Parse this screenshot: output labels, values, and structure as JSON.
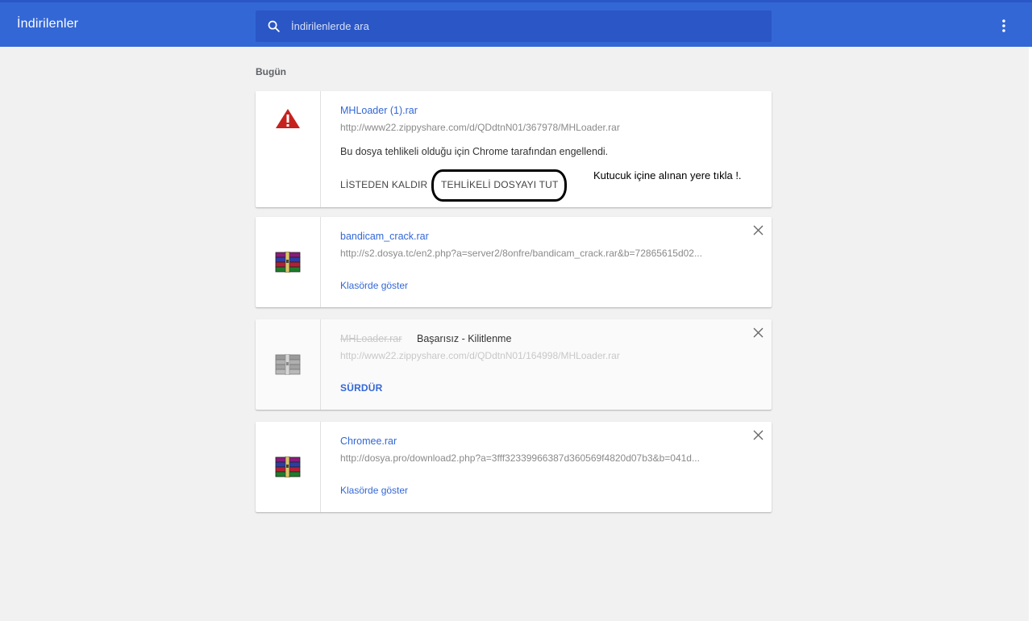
{
  "header": {
    "title": "İndirilenler",
    "search_placeholder": "İndirilenlerde ara"
  },
  "section": {
    "title": "Bugün"
  },
  "downloads": [
    {
      "file_name": "MHLoader (1).rar",
      "url": "http://www22.zippyshare.com/d/QDdtnN01/367978/MHLoader.rar",
      "description": "Bu dosya tehlikeli olduğu için Chrome tarafından engellendi.",
      "action_remove": "LİSTEDEN KALDIR",
      "action_keep": "TEHLİKELİ DOSYAYI TUT",
      "icon": "warning-icon"
    },
    {
      "file_name": "bandicam_crack.rar",
      "url": "http://s2.dosya.tc/en2.php?a=server2/8onfre/bandicam_crack.rar&b=72865615d02...",
      "action": "Klasörde göster",
      "icon": "winrar-icon"
    },
    {
      "file_name": "MHLoader.rar",
      "status": "Başarısız - Kilitlenme",
      "url": "http://www22.zippyshare.com/d/QDdtnN01/164998/MHLoader.rar",
      "action": "SÜRDÜR",
      "icon": "winrar-icon"
    },
    {
      "file_name": "Chromee.rar",
      "url": "http://dosya.pro/download2.php?a=3fff32339966387d360569f4820d07b3&b=041d...",
      "action": "Klasörde göster",
      "icon": "winrar-icon"
    }
  ],
  "annotation": "Kutucuk içine alınan yere tıkla !.",
  "colors": {
    "header_bg": "#3367d6",
    "search_bg": "#2a56c6",
    "link": "#3367d6",
    "danger": "#c5221f"
  }
}
